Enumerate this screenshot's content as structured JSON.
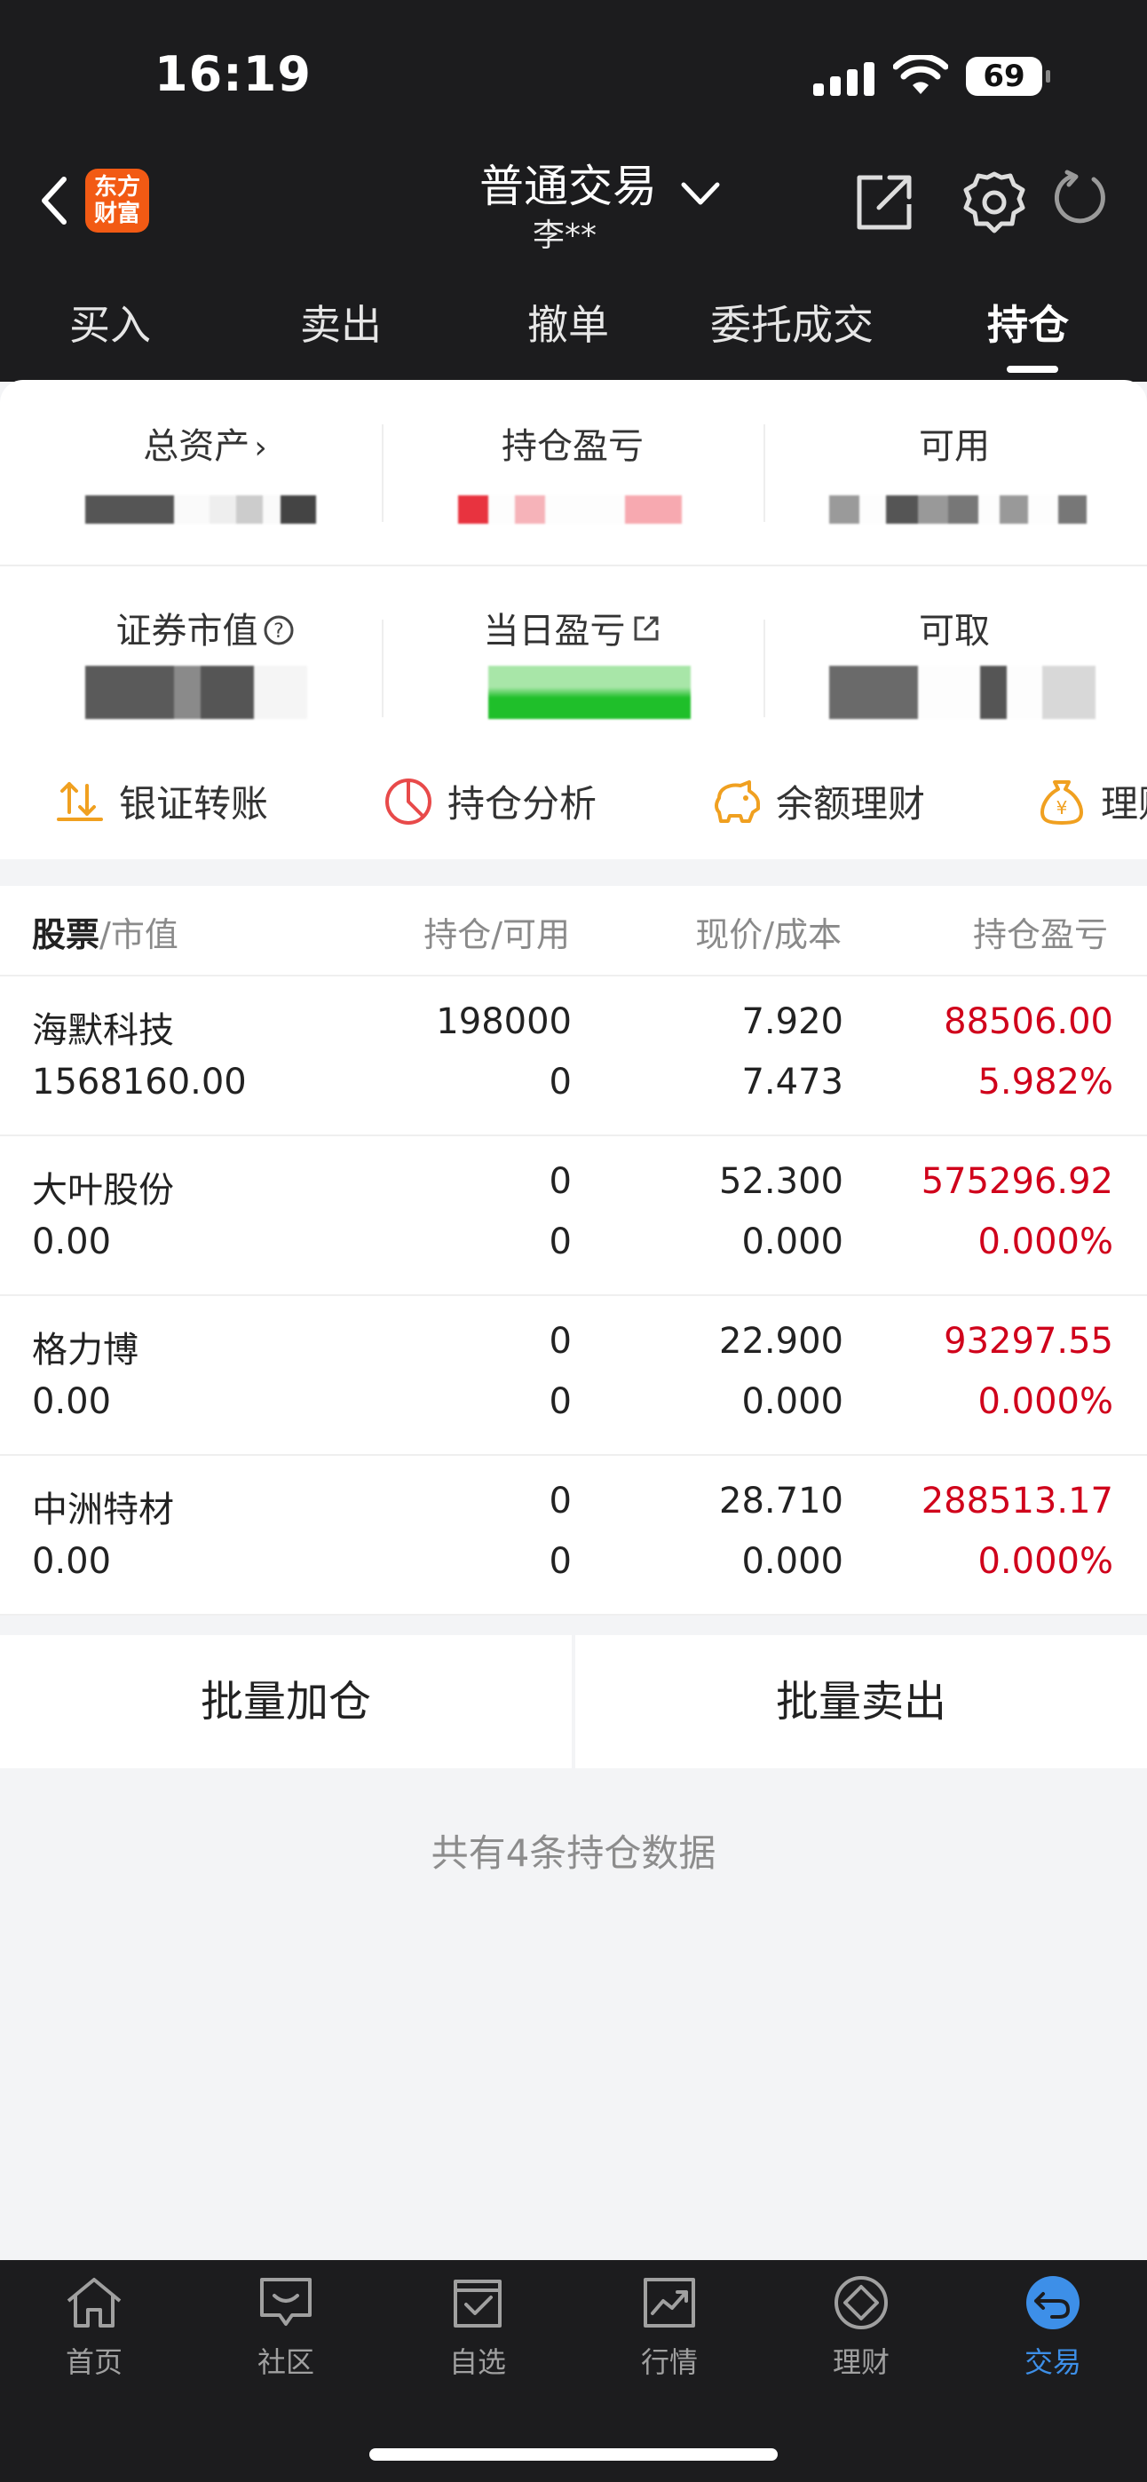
{
  "status_bar": {
    "time": "16:19",
    "battery": "69"
  },
  "header": {
    "logo_line1": "东方",
    "logo_line2": "财富",
    "title": "普通交易",
    "account": "李**"
  },
  "tabs": [
    {
      "label": "买入"
    },
    {
      "label": "卖出"
    },
    {
      "label": "撤单"
    },
    {
      "label": "委托成交"
    },
    {
      "label": "持仓"
    }
  ],
  "summary": {
    "total_assets_label": "总资产",
    "position_pl_label": "持仓盈亏",
    "available_label": "可用",
    "market_value_label": "证券市值",
    "daily_pl_label": "当日盈亏",
    "withdrawable_label": "可取"
  },
  "shortcuts": [
    {
      "label": "银证转账",
      "icon": "transfer-icon"
    },
    {
      "label": "持仓分析",
      "icon": "pie-chart-icon"
    },
    {
      "label": "余额理财",
      "icon": "piggy-bank-icon"
    },
    {
      "label": "理财",
      "icon": "money-bag-icon"
    }
  ],
  "table": {
    "headers": {
      "stock": "股票",
      "market_value": "/市值",
      "position": "持仓/可用",
      "price": "现价/成本",
      "pl": "持仓盈亏"
    },
    "rows": [
      {
        "name": "海默科技",
        "value": "1568160.00",
        "position": "198000",
        "available": "0",
        "price": "7.920",
        "cost": "7.473",
        "pl": "88506.00",
        "pl_pct": "5.982%"
      },
      {
        "name": "大叶股份",
        "value": "0.00",
        "position": "0",
        "available": "0",
        "price": "52.300",
        "cost": "0.000",
        "pl": "575296.92",
        "pl_pct": "0.000%"
      },
      {
        "name": "格力博",
        "value": "0.00",
        "position": "0",
        "available": "0",
        "price": "22.900",
        "cost": "0.000",
        "pl": "93297.55",
        "pl_pct": "0.000%"
      },
      {
        "name": "中洲特材",
        "value": "0.00",
        "position": "0",
        "available": "0",
        "price": "28.710",
        "cost": "0.000",
        "pl": "288513.17",
        "pl_pct": "0.000%"
      }
    ]
  },
  "actions": {
    "batch_add": "批量加仓",
    "batch_sell": "批量卖出"
  },
  "footer_note": "共有4条持仓数据",
  "bottom_nav": [
    {
      "label": "首页",
      "icon": "home-icon"
    },
    {
      "label": "社区",
      "icon": "community-icon"
    },
    {
      "label": "自选",
      "icon": "watchlist-icon"
    },
    {
      "label": "行情",
      "icon": "market-icon"
    },
    {
      "label": "理财",
      "icon": "wealth-icon"
    },
    {
      "label": "交易",
      "icon": "trade-icon"
    }
  ],
  "colors": {
    "accent_red": "#d0021b",
    "accent_blue": "#3d8fe8",
    "brand_orange": "#f25a14",
    "daily_pl_green": "#22c02e"
  }
}
